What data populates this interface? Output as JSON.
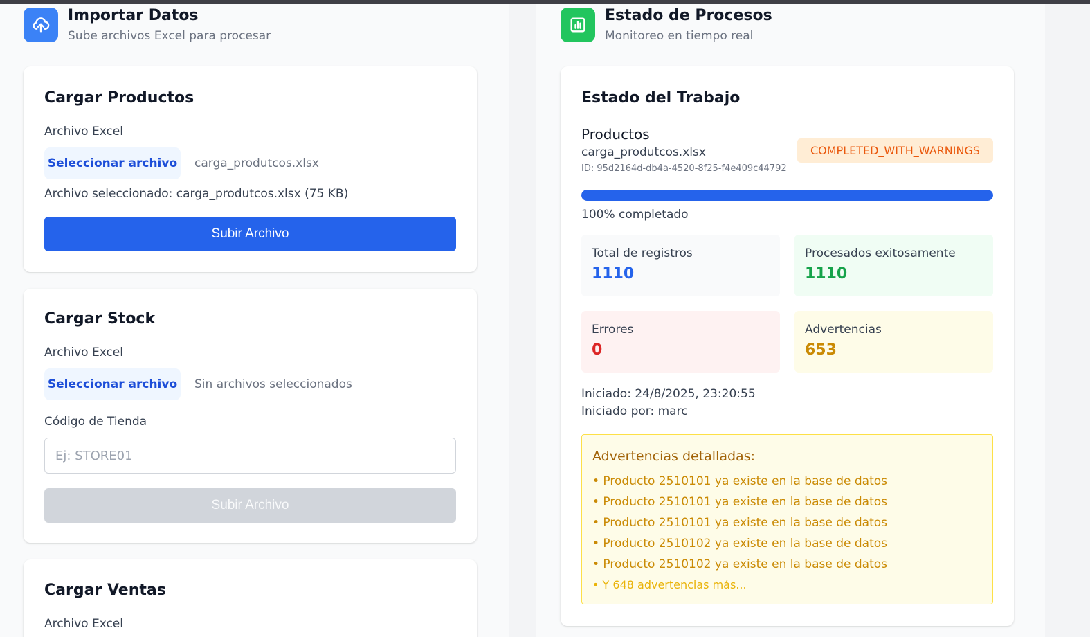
{
  "import_section": {
    "title": "Importar Datos",
    "subtitle": "Sube archivos Excel para procesar",
    "icon": "upload-cloud-icon",
    "icon_color": "#3b82f6"
  },
  "status_section": {
    "title": "Estado de Procesos",
    "subtitle": "Monitoreo en tiempo real",
    "icon": "bar-chart-icon",
    "icon_color": "#22c55e"
  },
  "products_card": {
    "title": "Cargar Productos",
    "file_label": "Archivo Excel",
    "file_button": "Seleccionar archivo",
    "file_name": "carga_produtcos.xlsx",
    "selected_info": "Archivo seleccionado: carga_produtcos.xlsx (75 KB)",
    "submit_label": "Subir Archivo"
  },
  "stock_card": {
    "title": "Cargar Stock",
    "file_label": "Archivo Excel",
    "file_button": "Seleccionar archivo",
    "file_name": "Sin archivos seleccionados",
    "store_label": "Código de Tienda",
    "store_placeholder": "Ej: STORE01",
    "store_value": "",
    "submit_label": "Subir Archivo",
    "submit_disabled": true
  },
  "sales_card": {
    "title": "Cargar Ventas",
    "file_label": "Archivo Excel"
  },
  "job": {
    "card_title": "Estado del Trabajo",
    "type": "Productos",
    "file_name": "carga_produtcos.xlsx",
    "id": "ID: 95d2164d-db4a-4520-8f25-f4e409c44792",
    "status": "COMPLETED_WITH_WARNINGS",
    "progress_percent": 100,
    "progress_label": "100% completado",
    "stats": {
      "total_label": "Total de registros",
      "total_value": "1110",
      "success_label": "Procesados exitosamente",
      "success_value": "1110",
      "errors_label": "Errores",
      "errors_value": "0",
      "warnings_label": "Advertencias",
      "warnings_value": "653"
    },
    "started": "Iniciado: 24/8/2025, 23:20:55",
    "started_by": "Iniciado por: marc",
    "warnings_title": "Advertencias detalladas:",
    "warnings_list": [
      "• Producto 2510101 ya existe en la base de datos",
      "• Producto 2510101 ya existe en la base de datos",
      "• Producto 2510101 ya existe en la base de datos",
      "• Producto 2510102 ya existe en la base de datos",
      "• Producto 2510102 ya existe en la base de datos"
    ],
    "warnings_more": "• Y 648 advertencias más..."
  },
  "colors": {
    "primary": "#2563eb",
    "status_badge_bg": "#ffedd5",
    "status_badge_text": "#ea580c",
    "total_bg": "#f9fafb",
    "total_text": "#2563eb",
    "success_bg": "#f0fdf4",
    "success_text": "#16a34a",
    "errors_bg": "#fef2f2",
    "errors_text": "#dc2626",
    "warnings_bg": "#fefce8",
    "warnings_text": "#ca8a04"
  }
}
